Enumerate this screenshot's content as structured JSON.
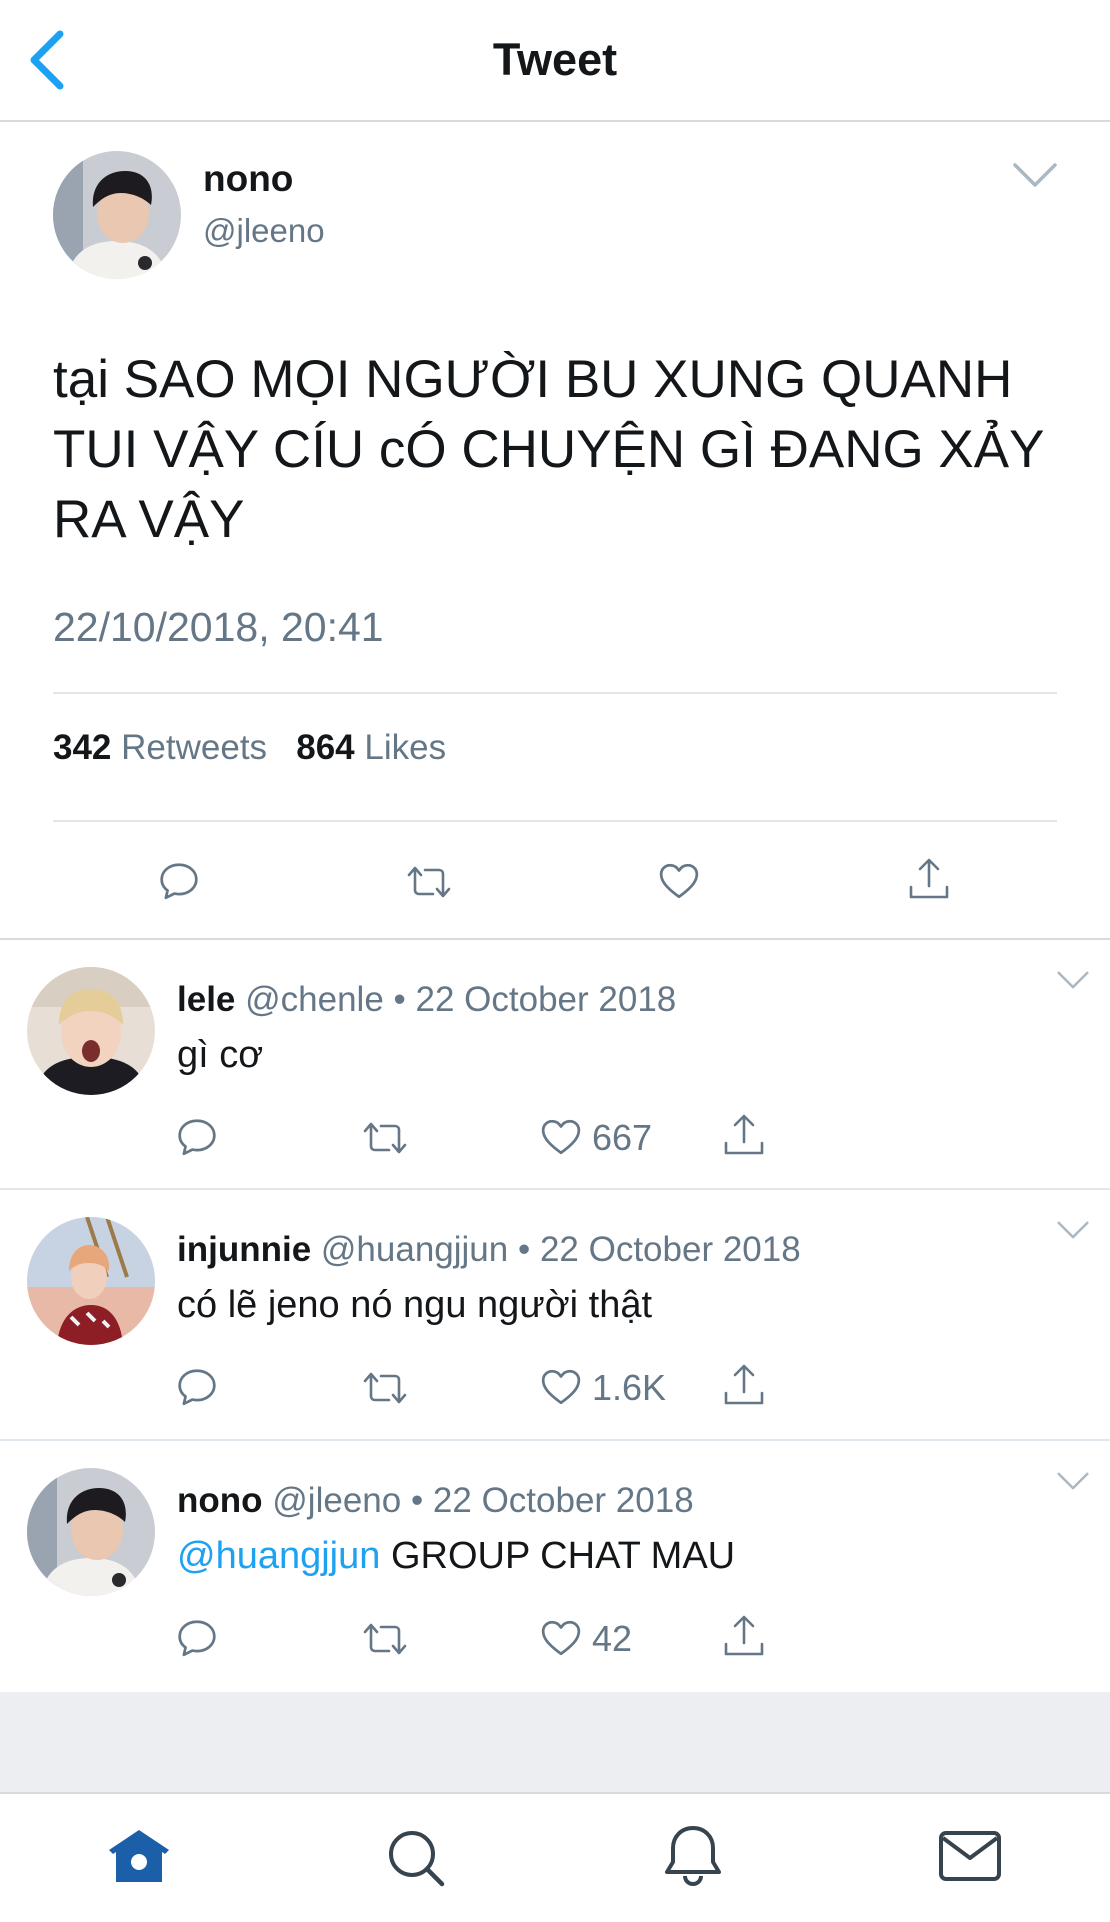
{
  "header": {
    "title": "Tweet",
    "back_icon": "chevron-left-icon"
  },
  "main_tweet": {
    "name": "nono",
    "handle": "@jleeno",
    "text": "tại SAO MỌI NGƯỜI BU XUNG QUANH TUI VẬY CÍU cÓ CHUYỆN GÌ ĐANG XẢY RA VẬY",
    "timestamp": "22/10/2018, 20:41",
    "retweets_count": "342",
    "retweets_label": "Retweets",
    "likes_count": "864",
    "likes_label": "Likes"
  },
  "replies": [
    {
      "name": "lele",
      "handle": "@chenle",
      "date": "• 22 October 2018",
      "mention": "",
      "text": "gì cơ",
      "likes": "667"
    },
    {
      "name": "injunnie",
      "handle": "@huangjjun",
      "date": "• 22 October 2018",
      "mention": "",
      "text": "có lẽ jeno nó ngu người thật",
      "likes": "1.6K"
    },
    {
      "name": "nono",
      "handle": "@jleeno",
      "date": "• 22 October 2018",
      "mention": "@huangjjun",
      "text": " GROUP CHAT MAU",
      "likes": "42"
    }
  ],
  "tabbar": [
    "home-icon",
    "search-icon",
    "notifications-icon",
    "messages-icon"
  ],
  "colors": {
    "accent": "#1da1f2",
    "muted": "#657786",
    "text": "#14171a",
    "home_active": "#1b5fa8"
  }
}
